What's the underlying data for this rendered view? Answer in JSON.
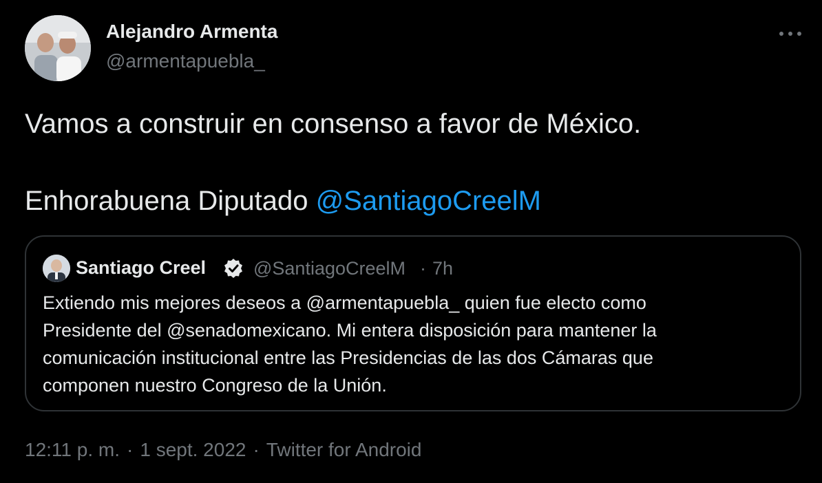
{
  "author": {
    "name": "Alejandro Armenta",
    "handle": "@armentapuebla_"
  },
  "tweet": {
    "line1": "Vamos a construir en consenso a favor de México.",
    "line2_prefix": "Enhorabuena Diputado ",
    "line2_mention": "@SantiagoCreelM"
  },
  "quote": {
    "name": "Santiago Creel",
    "verified_icon": "verified-badge-icon",
    "handle": "@SantiagoCreelM",
    "separator": "·",
    "time": "7h",
    "lines": [
      "Extiendo mis mejores deseos a @armentapuebla_ quien fue electo como",
      "Presidente del @senadomexicano. Mi entera disposición para mantener la",
      "comunicación institucional entre las Presidencias de las dos Cámaras que",
      "componen nuestro Congreso de la Unión."
    ]
  },
  "meta": {
    "time": "12:11 p. m.",
    "separator": "·",
    "date": "1 sept. 2022",
    "source": "Twitter for Android"
  },
  "colors": {
    "background": "#000000",
    "text": "#e7e9ea",
    "secondary": "#71767b",
    "link": "#1d9bf0",
    "border": "#2f3336"
  }
}
